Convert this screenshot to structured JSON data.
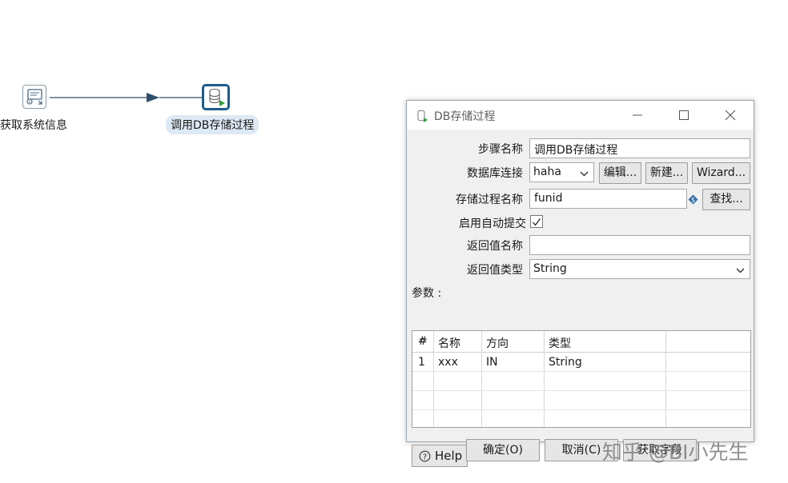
{
  "canvas": {
    "steps": [
      {
        "label": "获取系统信息",
        "icon": "system-info-icon",
        "selected": false
      },
      {
        "label": "调用DB存储过程",
        "icon": "db-procedure-icon",
        "selected": true
      }
    ],
    "hop_color": "#2f4f6a"
  },
  "dialog": {
    "title": "DB存储过程",
    "fields": {
      "step_name": {
        "label": "步骤名称",
        "value": "调用DB存储过程"
      },
      "connection": {
        "label": "数据库连接",
        "value": "haha",
        "edit_label": "编辑...",
        "new_label": "新建...",
        "wizard_label": "Wizard..."
      },
      "procedure": {
        "label": "存储过程名称",
        "value": "funid",
        "find_label": "查找..."
      },
      "auto_commit": {
        "label": "启用自动提交",
        "checked": true
      },
      "result_name": {
        "label": "返回值名称",
        "value": ""
      },
      "result_type": {
        "label": "返回值类型",
        "value": "String"
      }
    },
    "params": {
      "label": "参数 :",
      "columns": [
        "#",
        "名称",
        "方向",
        "类型"
      ],
      "rows": [
        {
          "num": "1",
          "name": "xxx",
          "direction": "IN",
          "type": "String"
        }
      ]
    },
    "buttons": {
      "help": "Help",
      "ok": "确定(O)",
      "cancel": "取消(C)",
      "get_fields": "获取字段"
    }
  },
  "watermark": "知乎 @BI小先生",
  "colors": {
    "accent": "#1d5d8a",
    "selected_bg": "#dde9f5",
    "dialog_bg": "#f0f0f0"
  }
}
